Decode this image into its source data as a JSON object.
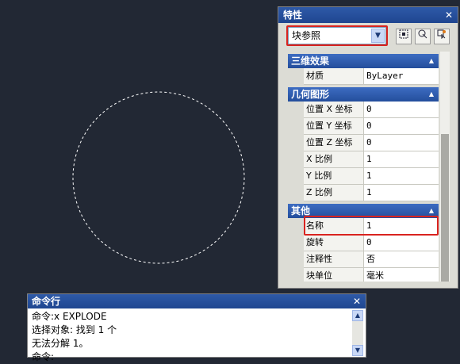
{
  "properties_palette": {
    "title": "特性",
    "close": "✕",
    "object_type": "块参照",
    "dropdown_arrow": "▼",
    "toolbar_icons": [
      "quick-select-icon",
      "select-objects-icon",
      "toggle-pickadd-icon"
    ],
    "collapse_glyph": "▲",
    "sections": [
      {
        "title": "三维效果",
        "rows": [
          {
            "label": "材质",
            "value": "ByLayer"
          }
        ]
      },
      {
        "title": "几何图形",
        "rows": [
          {
            "label": "位置 X 坐标",
            "value": "0"
          },
          {
            "label": "位置 Y 坐标",
            "value": "0"
          },
          {
            "label": "位置 Z 坐标",
            "value": "0"
          },
          {
            "label": "X 比例",
            "value": "1"
          },
          {
            "label": "Y 比例",
            "value": "1"
          },
          {
            "label": "Z 比例",
            "value": "1"
          }
        ]
      },
      {
        "title": "其他",
        "rows": [
          {
            "label": "名称",
            "value": "1"
          },
          {
            "label": "旋转",
            "value": "0"
          },
          {
            "label": "注释性",
            "value": "否"
          },
          {
            "label": "块单位",
            "value": "毫米"
          }
        ]
      }
    ]
  },
  "command_window": {
    "title": "命令行",
    "close": "✕",
    "lines": [
      "命令:x EXPLODE",
      "选择对象: 找到 1 个",
      "无法分解 1。",
      "命令:"
    ],
    "scroll_up": "▲",
    "scroll_down": "▼"
  },
  "colors": {
    "canvas_background": "#222834",
    "title_bar": "#244e9c",
    "highlight": "#d9231f",
    "circle": "#ffffff"
  }
}
